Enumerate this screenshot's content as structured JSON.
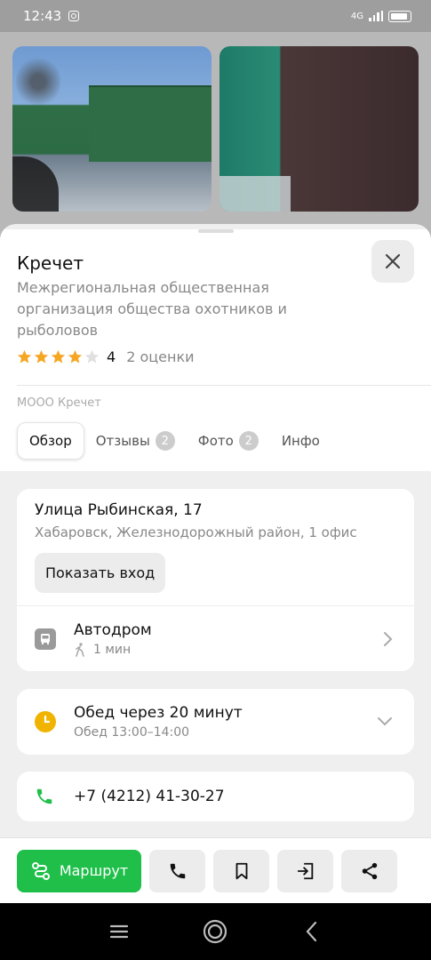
{
  "status_bar": {
    "time": "12:43",
    "network": "4G"
  },
  "place": {
    "title": "Кречет",
    "subtitle": "Межрегиональная общественная организация общества охотников и рыболовов",
    "rating_value": "4",
    "rating_stars": 4,
    "rating_count": "2 оценки",
    "org_name": "МООО Кречет"
  },
  "tabs": [
    {
      "label": "Обзор",
      "badge": null
    },
    {
      "label": "Отзывы",
      "badge": "2"
    },
    {
      "label": "Фото",
      "badge": "2"
    },
    {
      "label": "Инфо",
      "badge": null
    }
  ],
  "address": {
    "street": "Улица Рыбинская, 17",
    "district": "Хабаровск, Железнодорожный район, 1 офис",
    "entrance_button": "Показать вход"
  },
  "stop": {
    "name": "Автодром",
    "walk_time": "1 мин"
  },
  "hours": {
    "main": "Обед через 20 минут",
    "sub": "Обед 13:00–14:00"
  },
  "phone": {
    "number": "+7 (4212) 41-30-27"
  },
  "actions": {
    "route_label": "Маршрут"
  },
  "colors": {
    "accent_green": "#1fbf4a",
    "star": "#f5a623",
    "clock": "#f0b400",
    "phone": "#1fbf4a"
  }
}
